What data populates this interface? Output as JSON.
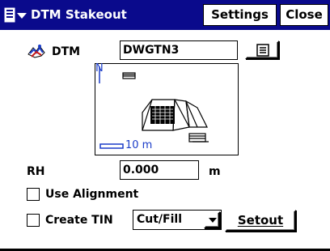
{
  "window": {
    "title": "DTM Stakeout",
    "settings_label": "Settings",
    "close_label": "Close",
    "title_bar_color": "#0a0a8c"
  },
  "form": {
    "dtm_label": "DTM",
    "dtm_value": "DWGTN3",
    "rh_label": "RH",
    "rh_value": "0.000",
    "rh_unit": "m",
    "use_alignment_label": "Use Alignment",
    "use_alignment_checked": false,
    "create_tin_label": "Create TIN",
    "create_tin_checked": false,
    "mode_selected": "Cut/Fill",
    "setout_label": "Setout"
  },
  "preview": {
    "north_label": "N",
    "scale_label": "10 m"
  },
  "icons": {
    "window_menu": "window-menu-icon",
    "dtm_surface": "terrain-icon",
    "browse": "list-icon",
    "dropdown": "chevron-down-icon"
  }
}
